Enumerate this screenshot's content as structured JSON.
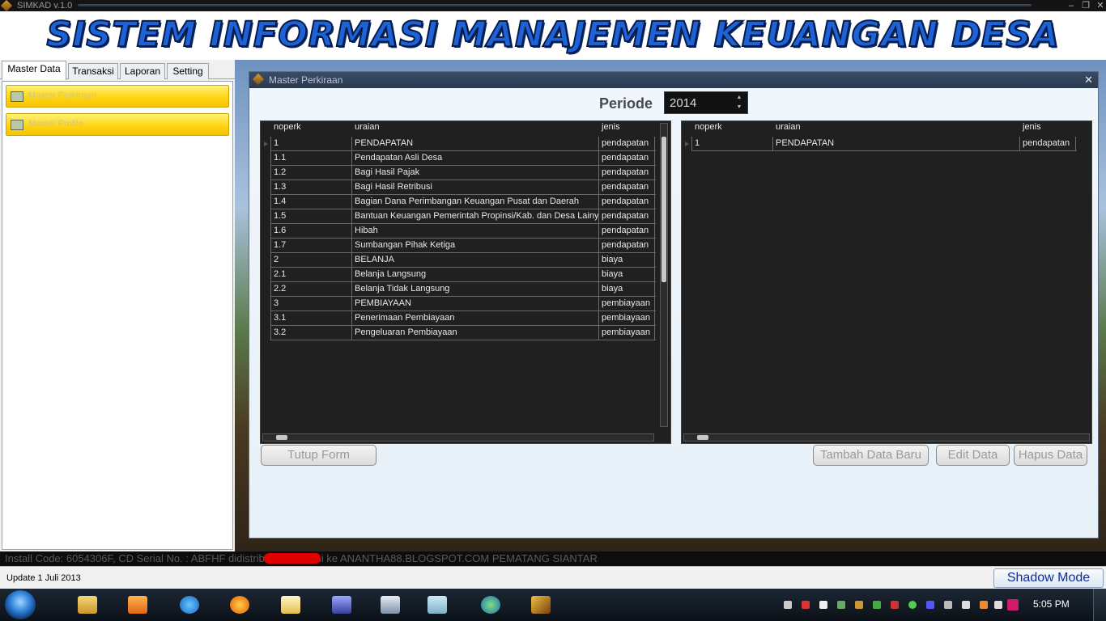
{
  "window": {
    "title": "SIMKAD v.1.0"
  },
  "banner": {
    "text": "SISTEM INFORMASI MANAJEMEN KEUANGAN DESA"
  },
  "tabs": [
    {
      "label": "Master Data",
      "active": true
    },
    {
      "label": "Transaksi",
      "active": false
    },
    {
      "label": "Laporan",
      "active": false
    },
    {
      "label": "Setting",
      "active": false
    }
  ],
  "sidebar": {
    "items": [
      {
        "label": "Master Perkiraan"
      },
      {
        "label": "Master Profile"
      }
    ]
  },
  "form": {
    "title": "Master Perkiraan",
    "close_glyph": "✕",
    "periode_label": "Periode",
    "periode_value": "2014",
    "left_table": {
      "columns": [
        "noperk",
        "uraian",
        "jenis"
      ],
      "rows": [
        [
          "1",
          "PENDAPATAN",
          "pendapatan"
        ],
        [
          "1.1",
          "Pendapatan Asli  Desa",
          "pendapatan"
        ],
        [
          "1.2",
          "Bagi Hasil Pajak",
          "pendapatan"
        ],
        [
          "1.3",
          "Bagi Hasil Retribusi",
          "pendapatan"
        ],
        [
          "1.4",
          "Bagian Dana Perimbangan Keuangan Pusat dan Daerah",
          "pendapatan"
        ],
        [
          "1.5",
          "Bantuan Keuangan Pemerintah Propinsi/Kab. dan Desa Lainya",
          "pendapatan"
        ],
        [
          "1.6",
          "Hibah",
          "pendapatan"
        ],
        [
          "1.7",
          "Sumbangan Pihak Ketiga",
          "pendapatan"
        ],
        [
          "2",
          "BELANJA",
          "biaya"
        ],
        [
          "2.1",
          "Belanja Langsung",
          "biaya"
        ],
        [
          "2.2",
          "Belanja Tidak Langsung",
          "biaya"
        ],
        [
          "3",
          "PEMBIAYAAN",
          "pembiayaan"
        ],
        [
          "3.1",
          "Penerimaan Pembiayaan",
          "pembiayaan"
        ],
        [
          "3.2",
          "Pengeluaran Pembiayaan",
          "pembiayaan"
        ]
      ]
    },
    "right_table": {
      "columns": [
        "noperk",
        "uraian",
        "jenis"
      ],
      "rows": [
        [
          "1",
          "PENDAPATAN",
          "pendapatan"
        ]
      ]
    },
    "buttons": {
      "close_form": "Tutup Form",
      "add": "Tambah Data Baru",
      "edit": "Edit Data",
      "delete": "Hapus Data"
    }
  },
  "install_bar": {
    "text": "Install Code: 6054306F, CD Serial No. : ABFHF                    didistribusikan resmi ke ANANTHA88.BLOGSPOT.COM PEMATANG SIANTAR"
  },
  "status": {
    "update_text": "Update 1 Juli 2013",
    "shadow_mode_label": "Shadow Mode"
  },
  "taskbar": {
    "clock": "5:05 PM",
    "apps": [
      "file-explorer-icon",
      "media-player-icon",
      "internet-explorer-icon",
      "firefox-icon",
      "notepad-icon",
      "display-icon",
      "window-icon",
      "book-icon",
      "globe-icon",
      "simkad-icon"
    ]
  },
  "colors": {
    "accent_yellow": "#ffd514",
    "banner_blue": "#1e63d6",
    "grid_bg": "#202020",
    "redaction": "#e00000"
  }
}
